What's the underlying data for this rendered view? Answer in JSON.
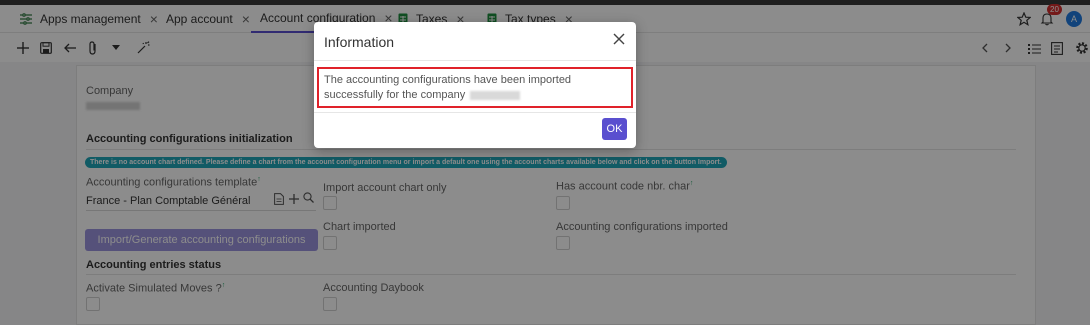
{
  "tabs": [
    {
      "label": "Apps management",
      "icon": "app-grid-icon"
    },
    {
      "label": "App account",
      "icon": ""
    },
    {
      "label": "Account configuration",
      "icon": "",
      "active": true
    },
    {
      "label": "Taxes",
      "icon": "spreadsheet-icon"
    },
    {
      "label": "Tax types",
      "icon": "spreadsheet-icon"
    }
  ],
  "header": {
    "notification_count": "20",
    "avatar_letter": "A"
  },
  "form": {
    "company_label": "Company",
    "section_init": "Accounting configurations initialization",
    "info_message": "There is no account chart defined. Please define a chart from the account configuration menu or import a default one using the account charts available below and click on the button Import.",
    "template_label": "Accounting configurations template",
    "template_value": "France - Plan Comptable Général",
    "import_chart_only_label": "Import account chart only",
    "has_account_code_label": "Has account code nbr. char",
    "chart_imported_label": "Chart imported",
    "configs_imported_label": "Accounting configurations imported",
    "import_button": "Import/Generate accounting configurations",
    "section_entries": "Accounting entries status",
    "simulated_moves_label": "Activate Simulated Moves ?",
    "daybook_label": "Accounting Daybook",
    "superscript_mark": "?"
  },
  "modal": {
    "title": "Information",
    "message": "The accounting configurations have been imported successfully for the company",
    "ok_label": "OK"
  },
  "colors": {
    "accent": "#5a4fcf",
    "info": "#20a6b8",
    "highlight": "#e0222a"
  }
}
